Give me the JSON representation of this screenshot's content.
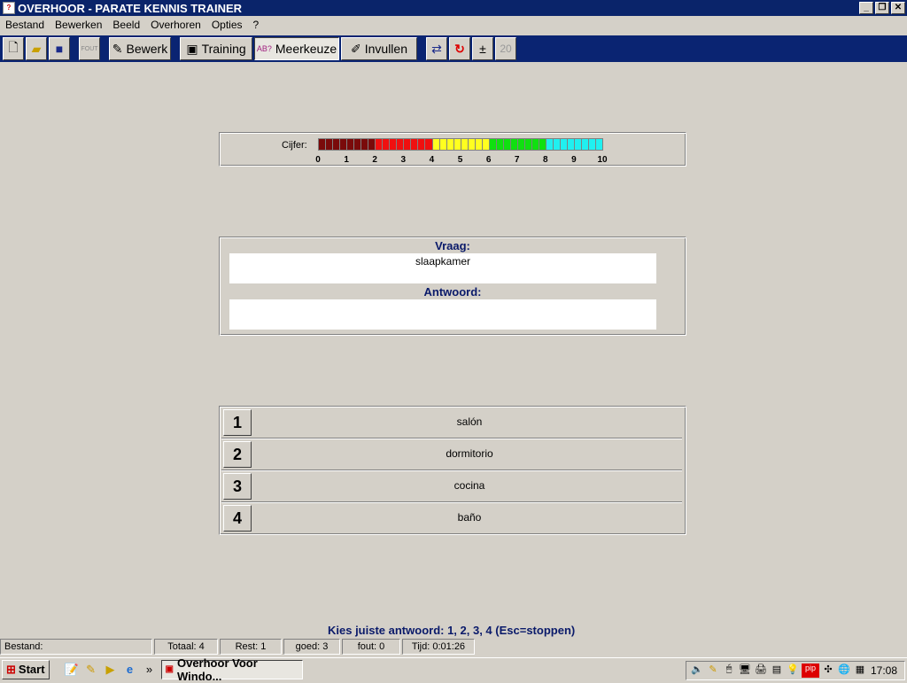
{
  "window": {
    "title": "OVERHOOR - PARATE KENNIS TRAINER",
    "minimize": "_",
    "restore": "❐",
    "close": "✕"
  },
  "menu": [
    "Bestand",
    "Bewerken",
    "Beeld",
    "Overhoren",
    "Opties",
    "?"
  ],
  "toolbar": {
    "bewerk": "Bewerk",
    "training": "Training",
    "meerkeuze": "Meerkeuze",
    "invullen": "Invullen",
    "plusminus": "±",
    "count": "20",
    "fout": "FOUT"
  },
  "gauge": {
    "label": "Cijfer:",
    "ticks": [
      "0",
      "1",
      "2",
      "3",
      "4",
      "5",
      "6",
      "7",
      "8",
      "9",
      "10"
    ],
    "colors": [
      "#7a0a0a",
      "#f01010",
      "#ffff20",
      "#10e010",
      "#20f0f0"
    ]
  },
  "question": {
    "vraag_label": "Vraag:",
    "vraag": "slaapkamer",
    "antwoord_label": "Antwoord:",
    "antwoord": ""
  },
  "choices": [
    {
      "n": "1",
      "text": "salón"
    },
    {
      "n": "2",
      "text": "dormitorio"
    },
    {
      "n": "3",
      "text": "cocina"
    },
    {
      "n": "4",
      "text": "baño"
    }
  ],
  "hint": "Kies juiste antwoord: 1, 2, 3, 4  (Esc=stoppen)",
  "status": {
    "bestand": "Bestand:",
    "totaal": "Totaal: 4",
    "rest": "Rest: 1",
    "goed": "goed: 3",
    "fout": "fout: 0",
    "tijd": "Tijd: 0:01:26"
  },
  "taskbar": {
    "start": "Start",
    "task": "Overhoor Voor Windo...",
    "chevron": "»",
    "clock": "17:08",
    "pip": "pip"
  }
}
